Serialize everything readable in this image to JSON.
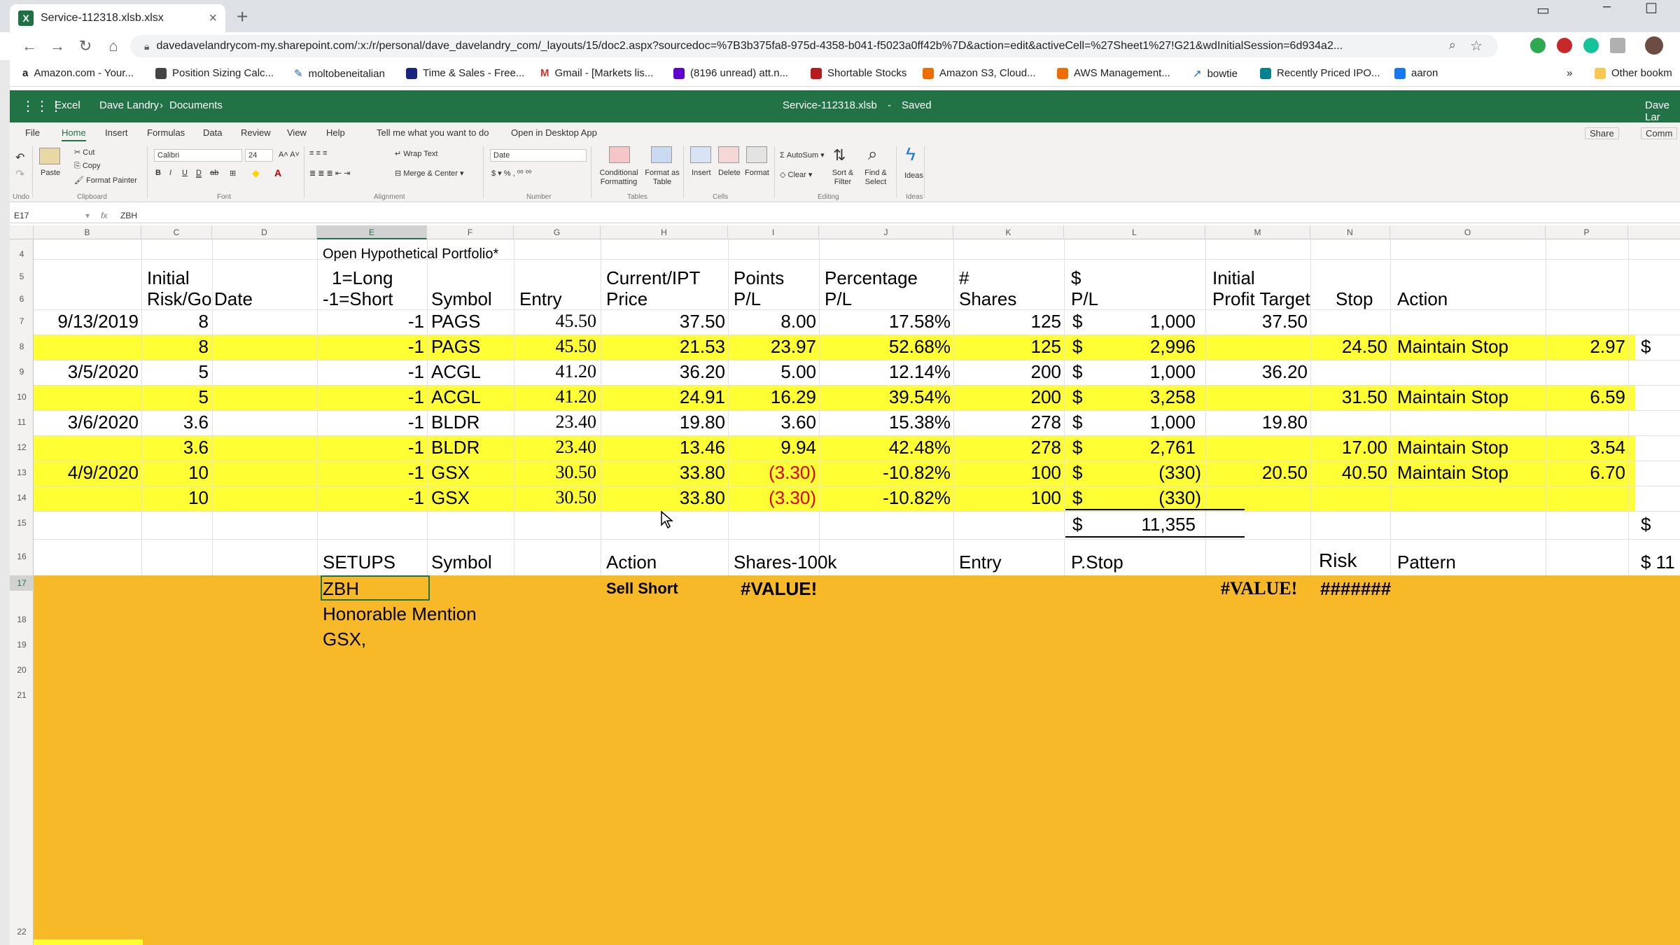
{
  "browser": {
    "tab_title": "Service-112318.xlsb.xlsx",
    "url": "davedavelandrycom-my.sharepoint.com/:x:/r/personal/dave_davelandry_com/_layouts/15/doc2.aspx?sourcedoc=%7B3b375fa8-975d-4358-b041-f5023a0ff42b%7D&action=edit&activeCell=%27Sheet1%27!G21&wdInitialSession=6d934a2...",
    "bookmarks": [
      "Amazon.com - Your...",
      "Position Sizing Calc...",
      "moltobeneitalian",
      "Time & Sales - Free...",
      "Gmail - [Markets lis...",
      "(8196 unread) att.n...",
      "Shortable Stocks",
      "Amazon S3, Cloud...",
      "AWS Management...",
      "bowtie",
      "Recently Priced IPO...",
      "aaron",
      "Other bookm"
    ]
  },
  "excel": {
    "app": "Excel",
    "breadcrumb_owner": "Dave Landry",
    "breadcrumb_folder": "Documents",
    "file_name": "Service-112318.xlsb",
    "save_status": "Saved",
    "user": "Dave Lar",
    "ribbon_tabs": [
      "File",
      "Home",
      "Insert",
      "Formulas",
      "Data",
      "Review",
      "View",
      "Help"
    ],
    "tell_me": "Tell me what you want to do",
    "open_desktop": "Open in Desktop App",
    "share": "Share",
    "comments": "Comm",
    "ribbon": {
      "undo": "Undo",
      "paste": "Paste",
      "cut": "Cut",
      "copy": "Copy",
      "format_painter": "Format Painter",
      "clipboard": "Clipboard",
      "font_name": "Calibri",
      "font_size": "24",
      "font_group": "Font",
      "wrap_text": "Wrap Text",
      "merge_center": "Merge & Center",
      "alignment": "Alignment",
      "number_format": "Date",
      "number": "Number",
      "conditional_formatting": "Conditional Formatting",
      "format_as_table": "Format as Table",
      "tables": "Tables",
      "insert": "Insert",
      "delete": "Delete",
      "format": "Format",
      "cells": "Cells",
      "autosum": "AutoSum",
      "clear": "Clear",
      "sort_filter": "Sort & Filter",
      "find_select": "Find & Select",
      "editing": "Editing",
      "ideas": "Ideas",
      "ideas_group": "Ideas"
    },
    "name_box": "E17",
    "formula": "ZBH",
    "columns": [
      "B",
      "C",
      "D",
      "E",
      "F",
      "G",
      "H",
      "I",
      "J",
      "K",
      "L",
      "M",
      "N",
      "O",
      "P"
    ],
    "rows": [
      "4",
      "5",
      "6",
      "7",
      "8",
      "9",
      "10",
      "11",
      "12",
      "13",
      "14",
      "15",
      "16",
      "17",
      "18",
      "19",
      "20",
      "21",
      "22"
    ]
  },
  "sheet": {
    "title": "Open Hypothetical Portfolio*",
    "header5": {
      "c": "Initial",
      "e": "1=Long",
      "h": "Current/IPT",
      "i": "Points",
      "j": "Percentage",
      "k": "#",
      "l": "$",
      "m": "Initial"
    },
    "header6": {
      "c": "Risk/Goal",
      "d": "Date",
      "e": "-1=Short",
      "f": "Symbol",
      "g": "Entry",
      "h": "Price",
      "i": "P/L",
      "j": "P/L",
      "k": "Shares",
      "l": "P/L",
      "m": "Profit Target",
      "n": "Stop",
      "o": "Action"
    },
    "rows": [
      {
        "date": "9/13/2019",
        "risk": "8",
        "dir": "-1",
        "sym": "PAGS",
        "entry": "45.50",
        "price": "37.50",
        "pts": "8.00",
        "pct": "17.58%",
        "shares": "125",
        "pl": "1,000",
        "target": "37.50",
        "stop": "",
        "action": "",
        "p": "",
        "q": "",
        "hl": false,
        "neg": false
      },
      {
        "date": "",
        "risk": "8",
        "dir": "-1",
        "sym": "PAGS",
        "entry": "45.50",
        "price": "21.53",
        "pts": "23.97",
        "pct": "52.68%",
        "shares": "125",
        "pl": "2,996",
        "target": "",
        "stop": "24.50",
        "action": "Maintain Stop",
        "p": "2.97",
        "q": "$",
        "hl": true,
        "neg": false
      },
      {
        "date": "3/5/2020",
        "risk": "5",
        "dir": "-1",
        "sym": "ACGL",
        "entry": "41.20",
        "price": "36.20",
        "pts": "5.00",
        "pct": "12.14%",
        "shares": "200",
        "pl": "1,000",
        "target": "36.20",
        "stop": "",
        "action": "",
        "p": "",
        "q": "",
        "hl": false,
        "neg": false
      },
      {
        "date": "",
        "risk": "5",
        "dir": "-1",
        "sym": "ACGL",
        "entry": "41.20",
        "price": "24.91",
        "pts": "16.29",
        "pct": "39.54%",
        "shares": "200",
        "pl": "3,258",
        "target": "",
        "stop": "31.50",
        "action": "Maintain Stop",
        "p": "6.59",
        "q": "",
        "hl": true,
        "neg": false
      },
      {
        "date": "3/6/2020",
        "risk": "3.6",
        "dir": "-1",
        "sym": "BLDR",
        "entry": "23.40",
        "price": "19.80",
        "pts": "3.60",
        "pct": "15.38%",
        "shares": "278",
        "pl": "1,000",
        "target": "19.80",
        "stop": "",
        "action": "",
        "p": "",
        "q": "",
        "hl": false,
        "neg": false
      },
      {
        "date": "",
        "risk": "3.6",
        "dir": "-1",
        "sym": "BLDR",
        "entry": "23.40",
        "price": "13.46",
        "pts": "9.94",
        "pct": "42.48%",
        "shares": "278",
        "pl": "2,761",
        "target": "",
        "stop": "17.00",
        "action": "Maintain Stop",
        "p": "3.54",
        "q": "",
        "hl": true,
        "neg": false
      },
      {
        "date": "4/9/2020",
        "risk": "10",
        "dir": "-1",
        "sym": "GSX",
        "entry": "30.50",
        "price": "33.80",
        "pts": "(3.30)",
        "pct": "-10.82%",
        "shares": "100",
        "pl": "(330)",
        "target": "20.50",
        "stop": "40.50",
        "action": "Maintain Stop",
        "p": "6.70",
        "q": "",
        "hl": true,
        "neg": true
      },
      {
        "date": "",
        "risk": "10",
        "dir": "-1",
        "sym": "GSX",
        "entry": "30.50",
        "price": "33.80",
        "pts": "(3.30)",
        "pct": "-10.82%",
        "shares": "100",
        "pl": "(330)",
        "target": "",
        "stop": "",
        "action": "",
        "p": "",
        "q": "",
        "hl": true,
        "neg": true
      }
    ],
    "total_dollar": "$",
    "total": "11,355",
    "row15_p": "$",
    "setups_header": {
      "e": "SETUPS",
      "f": "Symbol",
      "h": "Action",
      "i": "Shares-100k",
      "k": "Entry",
      "l": "P.Stop",
      "n": "Risk",
      "o": "Pattern",
      "p": "$ 11"
    },
    "setup": {
      "e": "ZBH",
      "h": "Sell Short",
      "i": "#VALUE!",
      "m": "#VALUE!",
      "n": "#######"
    },
    "honorable_mention": "Honorable Mention",
    "mention_list": "GSX,"
  },
  "colors": {
    "excel_green": "#217346",
    "highlight_yellow": "#ffff33",
    "orange_fill": "#f7b928",
    "negative_red": "#e00000"
  }
}
